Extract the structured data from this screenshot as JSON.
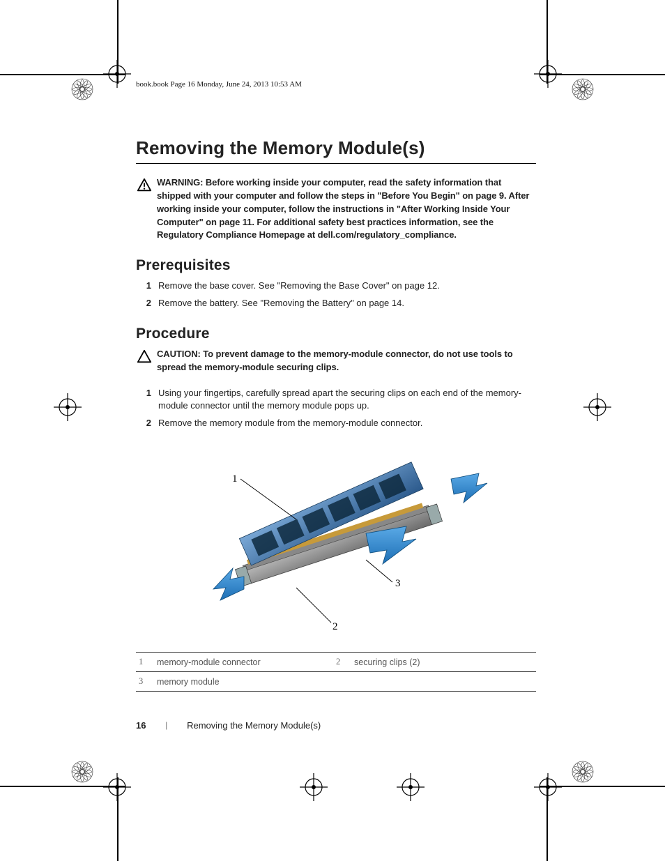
{
  "print_header": "book.book  Page 16  Monday, June 24, 2013  10:53 AM",
  "title": "Removing the Memory Module(s)",
  "warning": {
    "label": "WARNING: ",
    "text": "Before working inside your computer, read the safety information that shipped with your computer and follow the steps in \"Before You Begin\" on page 9. After working inside your computer, follow the instructions in \"After Working Inside Your Computer\" on page 11. For additional safety best practices information, see the Regulatory Compliance Homepage at dell.com/regulatory_compliance."
  },
  "sections": {
    "prereq_heading": "Prerequisites",
    "procedure_heading": "Procedure"
  },
  "prereq_steps": [
    "Remove the base cover. See \"Removing the Base Cover\" on page 12.",
    "Remove the battery. See \"Removing the Battery\" on page 14."
  ],
  "caution": {
    "label": "CAUTION: ",
    "text": "To prevent damage to the memory-module connector, do not use tools to spread the memory-module securing clips."
  },
  "procedure_steps": [
    "Using your fingertips, carefully spread apart the securing clips on each end of the memory-module connector until the memory module pops up.",
    "Remove the memory module from the memory-module connector."
  ],
  "diagram_labels": {
    "l1": "1",
    "l2": "2",
    "l3": "3"
  },
  "legend": {
    "r1c1_num": "1",
    "r1c1_txt": "memory-module connector",
    "r1c2_num": "2",
    "r1c2_txt": "securing clips (2)",
    "r2c1_num": "3",
    "r2c1_txt": "memory module"
  },
  "footer": {
    "page_number": "16",
    "section_name": "Removing the Memory Module(s)"
  }
}
